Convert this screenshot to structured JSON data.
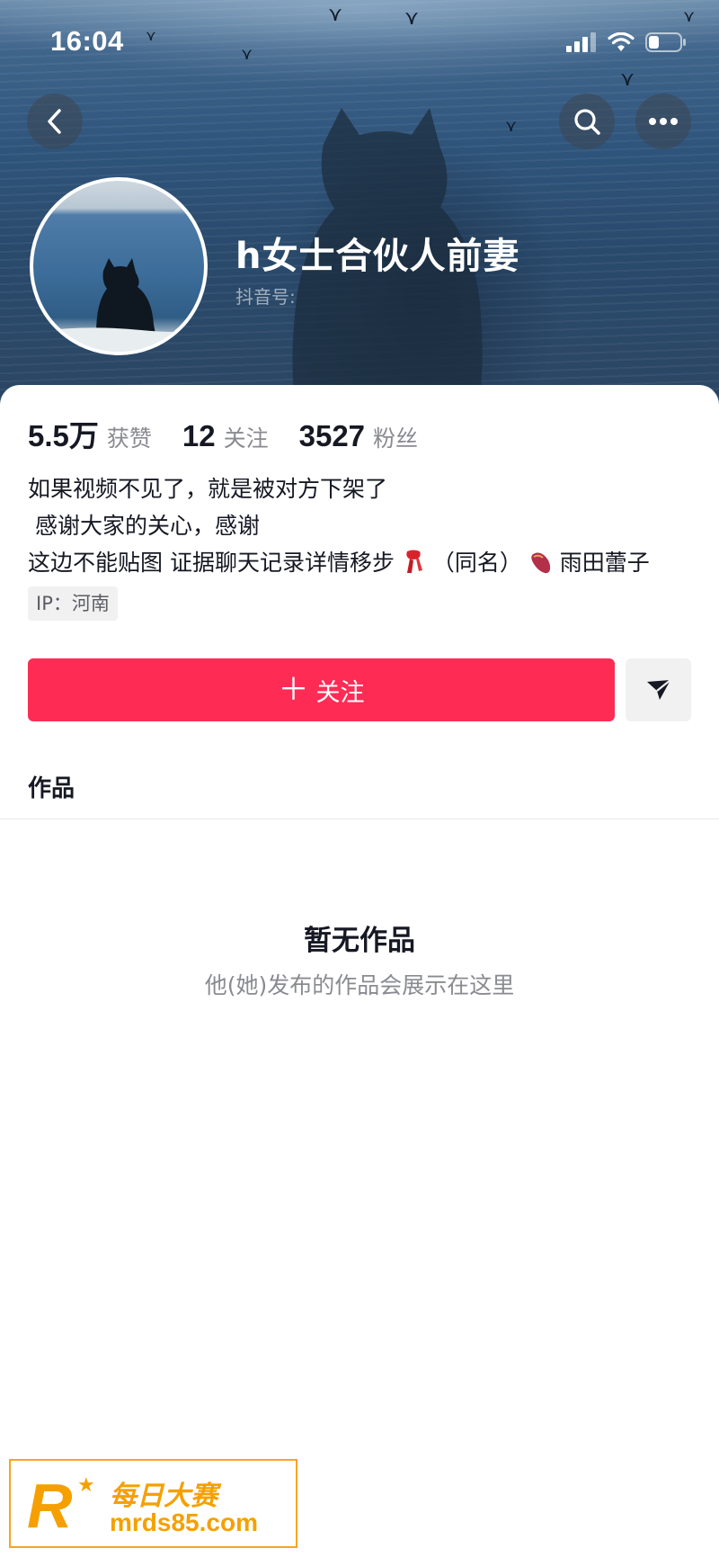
{
  "status_bar": {
    "time": "16:04"
  },
  "profile": {
    "username": "h女士合伙人前妻",
    "douyin_id_label": "抖音号:"
  },
  "stats": [
    {
      "value": "5.5万",
      "label": "获赞"
    },
    {
      "value": "12",
      "label": "关注"
    },
    {
      "value": "3527",
      "label": "粉丝"
    }
  ],
  "bio": {
    "line1": "如果视频不见了，就是被对方下架了",
    "line2": " 感谢大家的关心，感谢",
    "line3_part1": "这边不能贴图 证据聊天记录详情移步",
    "line3_part2": "（同名）",
    "line3_part3": "雨田蕾子",
    "emoji1_icon": "scarf-emoji-icon",
    "emoji2_icon": "sweet-potato-emoji-icon"
  },
  "ip_location": "IP：河南",
  "actions": {
    "follow_plus": "＋",
    "follow_label": "关注",
    "message_icon": "send-icon"
  },
  "tabs": {
    "works": "作品"
  },
  "empty_state": {
    "title": "暂无作品",
    "subtitle": "他(她)发布的作品会展示在这里"
  },
  "watermark": {
    "logo_letter": "R",
    "cn_text": "每日大赛",
    "url": "mrds85.com"
  },
  "colors": {
    "accent": "#fe2c55",
    "watermark": "#f5a623"
  }
}
